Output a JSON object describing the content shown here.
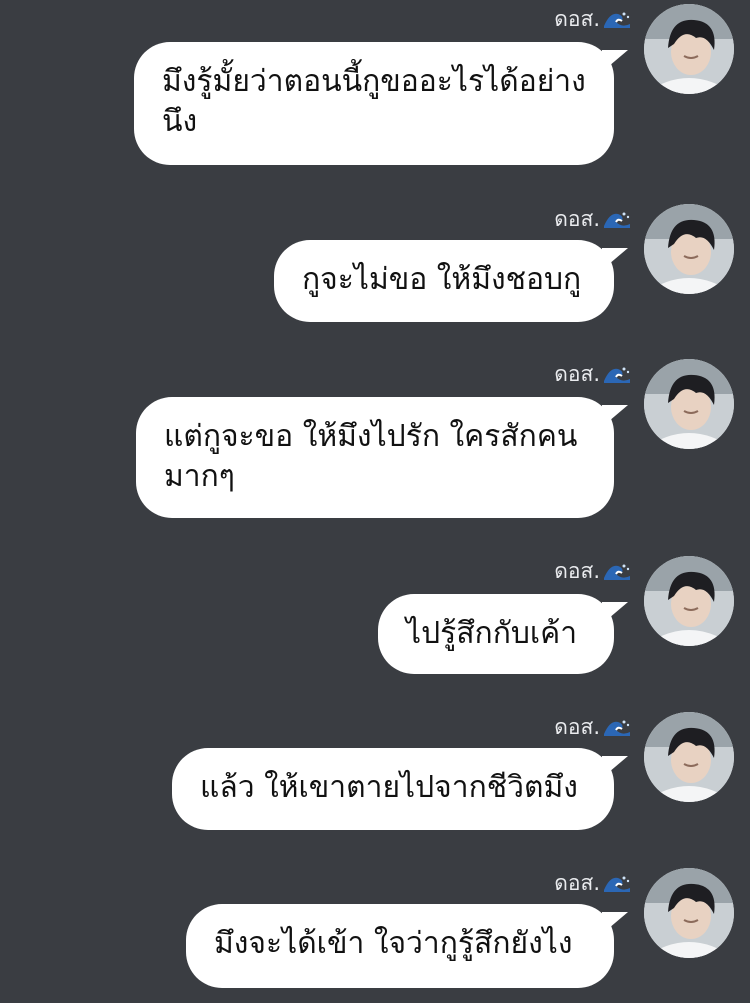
{
  "sender_name": "ดอส.",
  "sender_emoji": "wave-emoji",
  "messages": [
    {
      "lines": [
        "มึงรู้มั้ยว่าตอนนี้กูขออะไรได้อย่าง",
        "นึง"
      ]
    },
    {
      "lines": [
        "กูจะไม่ขอ ให้มึงชอบกู"
      ]
    },
    {
      "lines": [
        "แต่กูจะขอ ให้มึงไปรัก ใครสักคน",
        "มากๆ"
      ]
    },
    {
      "lines": [
        "ไปรู้สึกกับเค้า"
      ]
    },
    {
      "lines": [
        "แล้ว ให้เขาตายไปจากชีวิตมึง"
      ]
    },
    {
      "lines": [
        "มึงจะได้เข้า ใจว่ากูรู้สึกยังไง"
      ]
    }
  ],
  "colors": {
    "background": "#3a3d42",
    "bubble": "#ffffff",
    "bubble_text": "#111111",
    "sender_text": "#e9ebee"
  }
}
